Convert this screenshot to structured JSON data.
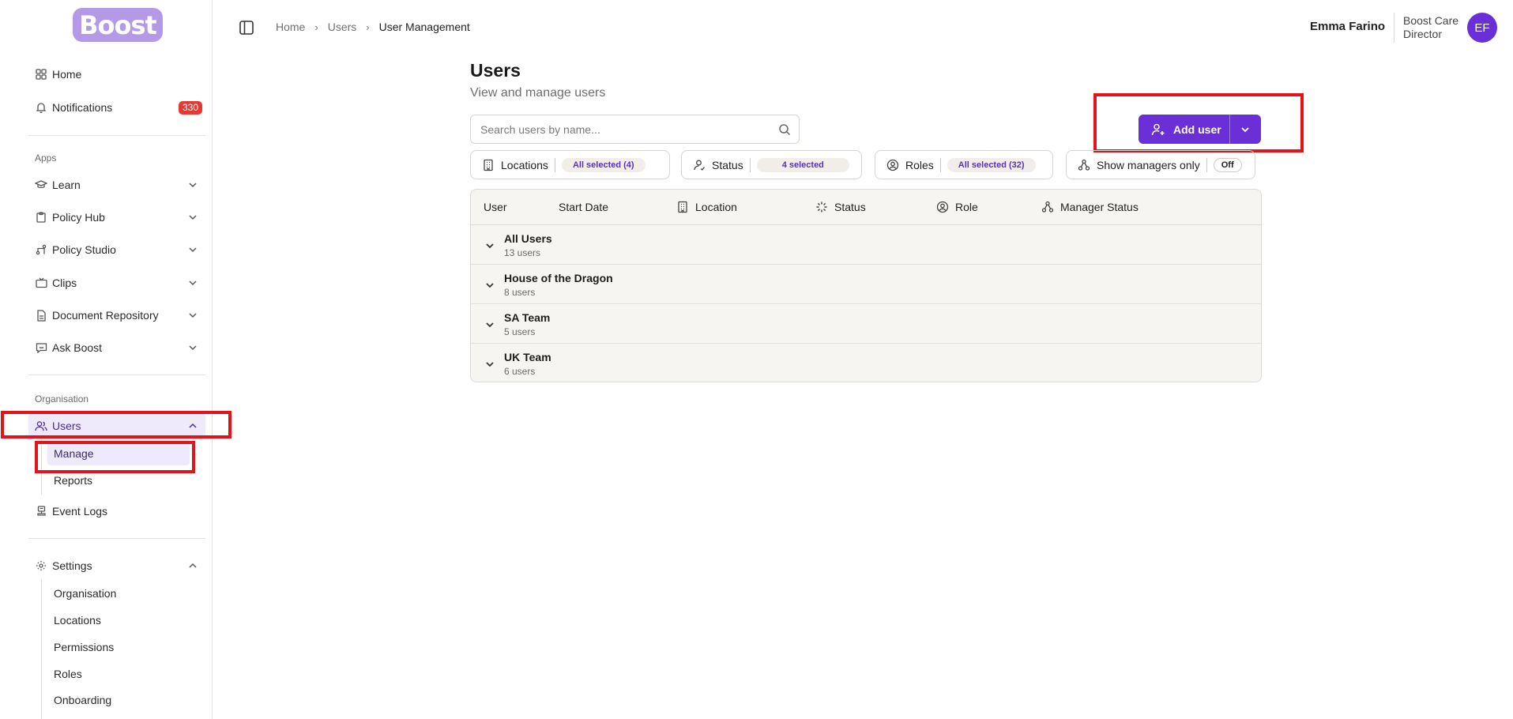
{
  "sidebar": {
    "logo": "Boost",
    "home": "Home",
    "notifications": "Notifications",
    "notifications_count": "330",
    "apps_label": "Apps",
    "apps": [
      {
        "label": "Learn",
        "icon": "graduation-cap-icon"
      },
      {
        "label": "Policy Hub",
        "icon": "clipboard-icon"
      },
      {
        "label": "Policy Studio",
        "icon": "route-icon"
      },
      {
        "label": "Clips",
        "icon": "tv-icon"
      },
      {
        "label": "Document Repository",
        "icon": "file-icon"
      },
      {
        "label": "Ask Boost",
        "icon": "message-icon"
      }
    ],
    "organisation_label": "Organisation",
    "users": "Users",
    "users_sub": [
      "Manage",
      "Reports"
    ],
    "event_logs": "Event Logs",
    "settings": "Settings",
    "settings_sub": [
      "Organisation",
      "Locations",
      "Permissions",
      "Roles",
      "Onboarding"
    ]
  },
  "breadcrumb": [
    "Home",
    "Users",
    "User Management"
  ],
  "user": {
    "name": "Emma Farino",
    "org": "Boost Care Director",
    "initials": "EF"
  },
  "main": {
    "title": "Users",
    "subtitle": "View and manage users",
    "search_placeholder": "Search users by name...",
    "add_user": "Add user"
  },
  "filters": [
    {
      "label": "Locations",
      "value": "All selected (4)",
      "icon": "building-icon"
    },
    {
      "label": "Status",
      "value": "4 selected",
      "icon": "user-status-icon"
    },
    {
      "label": "Roles",
      "value": "All selected (32)",
      "icon": "user-circle-icon"
    },
    {
      "label": "Show managers only",
      "value": "Off",
      "icon": "hierarchy-icon"
    }
  ],
  "table": {
    "columns": [
      "User",
      "Start Date",
      "Location",
      "Status",
      "Role",
      "Manager Status"
    ],
    "groups": [
      {
        "name": "All Users",
        "count": "13 users"
      },
      {
        "name": "House of the Dragon",
        "count": "8 users"
      },
      {
        "name": "SA Team",
        "count": "5 users"
      },
      {
        "name": "UK Team",
        "count": "6 users"
      }
    ]
  },
  "colors": {
    "accent": "#6a2fd6",
    "highlight": "#e3131b",
    "badge": "#e53935"
  }
}
